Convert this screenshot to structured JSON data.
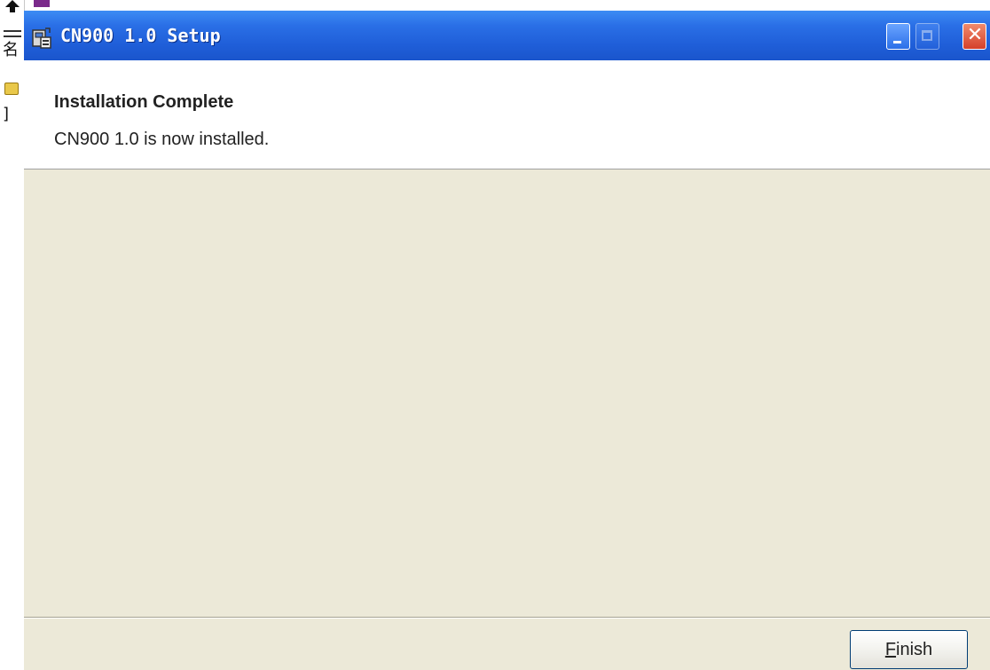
{
  "window": {
    "title": "CN900 1.0 Setup",
    "controls": {
      "minimize_icon": "minimize-icon",
      "maximize_icon": "maximize-icon",
      "close_icon": "close-icon"
    },
    "title_bar_color": "#1f5ed8"
  },
  "header": {
    "title": "Installation Complete",
    "subtitle": "CN900 1.0 is now installed."
  },
  "footer": {
    "finish_button": {
      "mnemonic": "F",
      "rest": "inish"
    }
  },
  "colors": {
    "client_background": "#ece9d8",
    "header_background": "#ffffff",
    "button_border": "#003c74"
  }
}
